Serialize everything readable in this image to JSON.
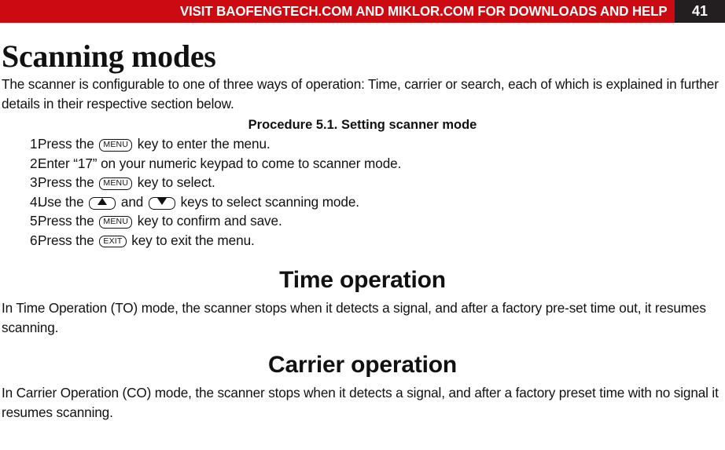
{
  "header": {
    "banner_text": "VISIT BAOFENGTECH.COM AND MIKLOR.COM FOR DOWNLOADS AND HELP",
    "page_number": "41",
    "banner_color": "#cc0a11",
    "page_number_bg": "#231f20",
    "banner_text_color": "#ffffff"
  },
  "chapter": {
    "title": "Scanning modes",
    "intro": "The scanner is configurable to one of three ways of operation: Time, carrier or search, each of which is explained in further details in their respective section below."
  },
  "procedure": {
    "caption": "Procedure 5.1. Setting scanner mode",
    "steps": [
      {
        "number": "1.",
        "before": "Press the",
        "key": "MENU",
        "key_type": "text",
        "after": "key to enter the menu."
      },
      {
        "number": "2.",
        "before": "Enter “17” on your numeric keypad to come to scanner mode.",
        "key": "",
        "key_type": "none",
        "after": ""
      },
      {
        "number": "3.",
        "before": "Press the",
        "key": "MENU",
        "key_type": "text",
        "after": "key to select."
      },
      {
        "number": "4.",
        "before": "Use the",
        "key": "up-arrow",
        "key_type": "arrow-up",
        "middle": "and",
        "key2": "down-arrow",
        "key2_type": "arrow-down",
        "after": "keys to select scanning mode."
      },
      {
        "number": "5.",
        "before": "Press the",
        "key": "MENU",
        "key_type": "text",
        "after": "key to confirm and save."
      },
      {
        "number": "6.",
        "before": "Press the",
        "key": "EXIT",
        "key_type": "text",
        "after": "key to exit the menu."
      }
    ]
  },
  "sections": [
    {
      "heading": "Time operation",
      "body": "In Time Operation (TO) mode, the scanner stops when it detects a signal, and after a factory pre-set time out, it resumes scanning."
    },
    {
      "heading": "Carrier operation",
      "body": "In Carrier Operation (CO) mode, the scanner stops when it detects a signal, and after a factory preset time with no signal it resumes scanning."
    }
  ]
}
